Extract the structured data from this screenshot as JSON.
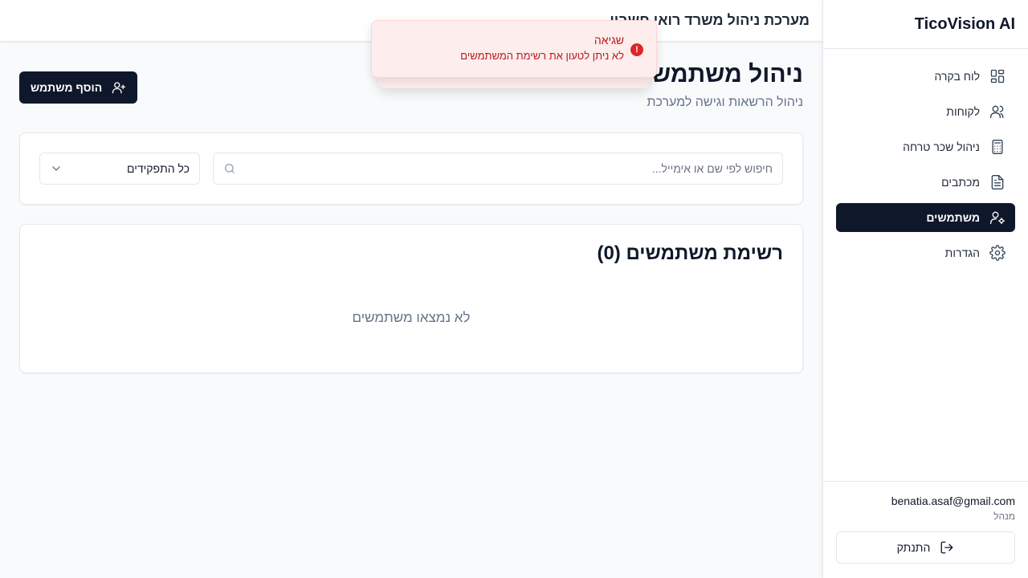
{
  "app": {
    "brand": "TicoVision AI",
    "topbar_title": "מערכת ניהול משרד רואי חשבון"
  },
  "sidebar": {
    "items": [
      {
        "label": "לוח בקרה",
        "icon": "dashboard-icon"
      },
      {
        "label": "לקוחות",
        "icon": "users-icon"
      },
      {
        "label": "ניהול שכר טרחה",
        "icon": "calculator-icon"
      },
      {
        "label": "מכתבים",
        "icon": "document-icon"
      },
      {
        "label": "משתמשים",
        "icon": "user-cog-icon",
        "active": true
      },
      {
        "label": "הגדרות",
        "icon": "gear-icon"
      }
    ]
  },
  "user": {
    "email": "benatia.asaf@gmail.com",
    "role": "מנהל",
    "logout_label": "התנתק"
  },
  "page": {
    "title": "ניהול משתמשים",
    "subtitle": "ניהול הרשאות וגישה למערכת",
    "add_user_label": "הוסף משתמש"
  },
  "filters": {
    "search_placeholder": "חיפוש לפי שם או אימייל...",
    "role_selected": "כל התפקידים"
  },
  "users_list": {
    "title": "רשימת משתמשים (0)",
    "empty_message": "לא נמצאו משתמשים"
  },
  "toast": {
    "title": "שגיאה",
    "message": "לא ניתן לטעון את רשימת המשתמשים"
  },
  "colors": {
    "primary": "#0f172a",
    "error": "#dc2626",
    "toast_bg": "#fdeded"
  }
}
